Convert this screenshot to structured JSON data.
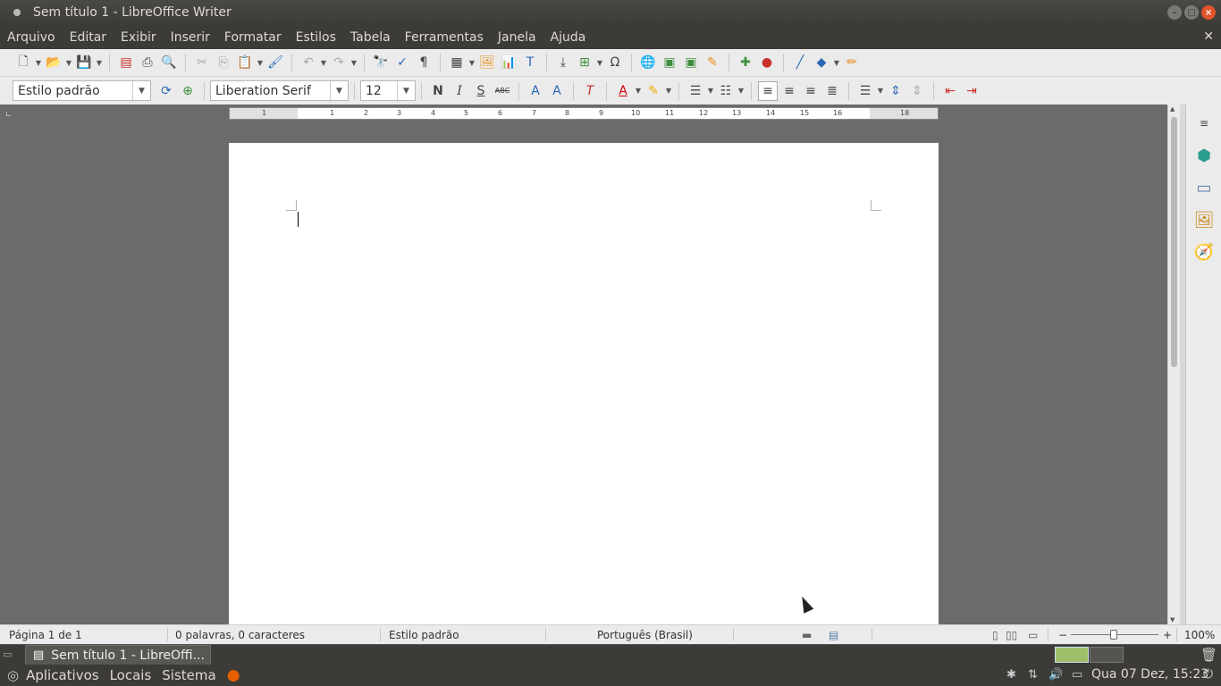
{
  "window": {
    "title": "Sem título 1 - LibreOffice Writer"
  },
  "menu": [
    "Arquivo",
    "Editar",
    "Exibir",
    "Inserir",
    "Formatar",
    "Estilos",
    "Tabela",
    "Ferramentas",
    "Janela",
    "Ajuda"
  ],
  "formatting": {
    "paragraph_style": "Estilo padrão",
    "font_name": "Liberation Serif",
    "font_size": "12",
    "bold_label": "N",
    "italic_label": "I",
    "underline_label": "S",
    "strike_label": "ABC"
  },
  "ruler": {
    "labels": [
      "1",
      "1",
      "2",
      "3",
      "4",
      "5",
      "6",
      "7",
      "8",
      "9",
      "10",
      "11",
      "12",
      "13",
      "14",
      "15",
      "16",
      "18"
    ]
  },
  "status": {
    "page": "Página 1 de 1",
    "words": "0 palavras, 0 caracteres",
    "style": "Estilo padrão",
    "language": "Português (Brasil)",
    "zoom_minus": "−",
    "zoom_plus": "+",
    "zoom": "100%"
  },
  "taskbar": {
    "task_label": "Sem título 1 - LibreOffi..."
  },
  "panel": {
    "apps": "Aplicativos",
    "places": "Locais",
    "system": "Sistema",
    "clock": "Qua 07 Dez, 15:23"
  }
}
